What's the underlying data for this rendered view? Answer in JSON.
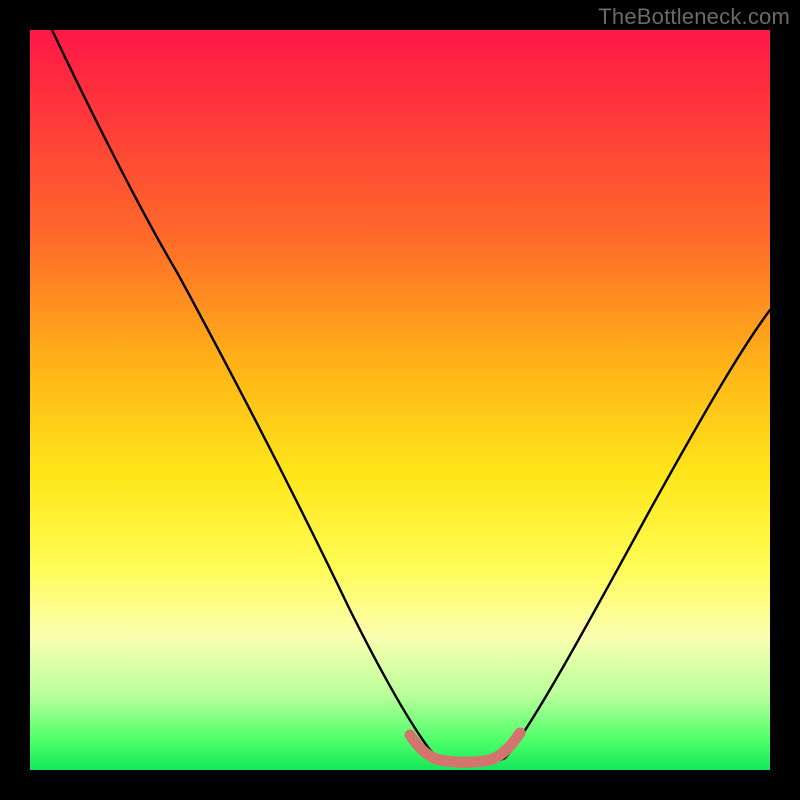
{
  "watermark": "TheBottleneck.com",
  "chart_data": {
    "type": "line",
    "title": "",
    "xlabel": "",
    "ylabel": "",
    "xlim": [
      0,
      100
    ],
    "ylim": [
      0,
      100
    ],
    "grid": false,
    "series": [
      {
        "name": "curve",
        "color": "#000000",
        "x": [
          3,
          10,
          20,
          30,
          40,
          47,
          52,
          55,
          58,
          62,
          65,
          70,
          80,
          90,
          100
        ],
        "y": [
          100,
          86,
          67,
          48,
          29,
          15,
          7,
          3,
          2,
          2,
          3,
          10,
          28,
          45,
          62
        ]
      },
      {
        "name": "trough-highlight",
        "color": "#d4746e",
        "x": [
          51,
          53,
          55,
          58,
          62,
          64,
          66
        ],
        "y": [
          6,
          3.5,
          2.5,
          2,
          2,
          3,
          5
        ]
      }
    ],
    "gradient_stops": [
      {
        "pos": 0,
        "color": "#ff1846"
      },
      {
        "pos": 12,
        "color": "#ff3a3a"
      },
      {
        "pos": 28,
        "color": "#ff6a2a"
      },
      {
        "pos": 45,
        "color": "#ffb218"
      },
      {
        "pos": 60,
        "color": "#ffe61a"
      },
      {
        "pos": 72,
        "color": "#fffb52"
      },
      {
        "pos": 82,
        "color": "#fbffb0"
      },
      {
        "pos": 90,
        "color": "#b8ff9a"
      },
      {
        "pos": 96,
        "color": "#4dff6a"
      },
      {
        "pos": 100,
        "color": "#14e85a"
      }
    ]
  }
}
